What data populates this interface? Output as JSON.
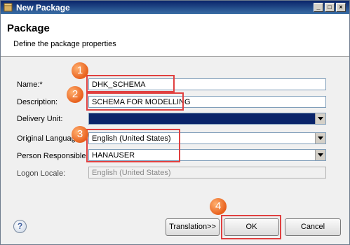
{
  "window": {
    "title": "New Package"
  },
  "header": {
    "title": "Package",
    "subtitle": "Define the package properties"
  },
  "form": {
    "name_label": "Name:*",
    "name_value": "DHK_SCHEMA",
    "description_label": "Description:",
    "description_value": "SCHEMA FOR MODELLING",
    "delivery_unit_label": "Delivery Unit:",
    "delivery_unit_value": "",
    "original_language_label": "Original Language:",
    "original_language_value": "English (United States)",
    "person_responsible_label": "Person Responsible:",
    "person_responsible_value": "HANAUSER",
    "logon_locale_label": "Logon Locale:",
    "logon_locale_value": "English (United States)"
  },
  "markers": [
    "1",
    "2",
    "3",
    "4"
  ],
  "buttons": {
    "translation": "Translation>>",
    "ok": "OK",
    "cancel": "Cancel"
  },
  "icons": {
    "window": "package-icon",
    "help": "help-icon",
    "minimize": "minimize-icon",
    "maximize": "maximize-icon",
    "close": "close-icon"
  },
  "colors": {
    "annotation": "#e04040",
    "badge": "#e8601c",
    "titlebar": "#0a246a"
  }
}
